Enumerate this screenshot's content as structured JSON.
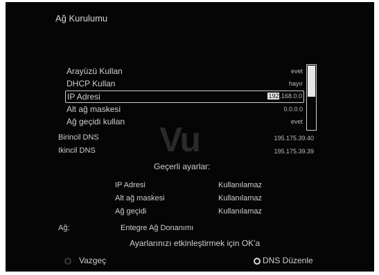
{
  "header": {
    "title": "Ağ Kurulumu"
  },
  "watermark": "Vu",
  "menu": [
    {
      "label": "Arayüzü Kullan",
      "value": "evet"
    },
    {
      "label": "DHCP Kullan",
      "value": "hayır"
    },
    {
      "label": "IP Adresi",
      "value_selected": "192",
      "value_rest": ".168.0.0"
    },
    {
      "label": "Alt ağ maskesi",
      "value": "0.0.0.0"
    },
    {
      "label": "Ağ geçidi kullan",
      "value": "evet"
    }
  ],
  "dns": [
    {
      "label": "Birincil DNS",
      "value": "195.175.39.40"
    },
    {
      "label": "Ikincil DNS",
      "value": "195.175.39.39"
    }
  ],
  "current": {
    "heading": "Geçerli ayarlar:",
    "rows": [
      {
        "label": "IP Adresi",
        "value": "Kullanılamaz"
      },
      {
        "label": "Alt ağ maskesi",
        "value": "Kullanılamaz"
      },
      {
        "label": "Ağ geçidi",
        "value": "Kullanılamaz"
      }
    ]
  },
  "network": {
    "label": "Ağ:",
    "value": "Entegre Ağ Donanımı"
  },
  "hint": "Ayarlarınızı etkinleştirmek için OK'a",
  "buttons": {
    "cancel": "Vazgeç",
    "dns_edit": "DNS Düzenle"
  },
  "scroll_position_fraction": 0.0
}
